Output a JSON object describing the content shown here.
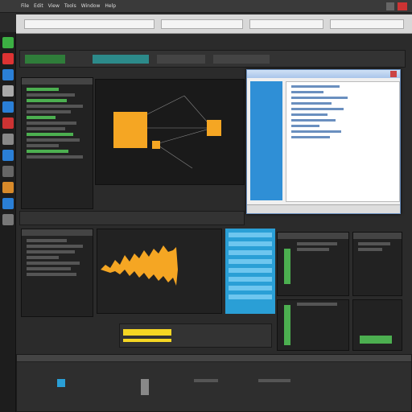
{
  "topbar": {
    "menu": [
      "File",
      "Edit",
      "View",
      "Tools",
      "Window",
      "Help"
    ]
  },
  "colors": {
    "accent_orange": "#f5a623",
    "accent_green": "#4caf50",
    "accent_blue": "#2a9fd6",
    "background": "#2b2b2b"
  },
  "icons": [
    "close-icon",
    "minimize-icon",
    "maximize-icon",
    "app-icon",
    "folder-icon"
  ],
  "window": {
    "title": ""
  }
}
